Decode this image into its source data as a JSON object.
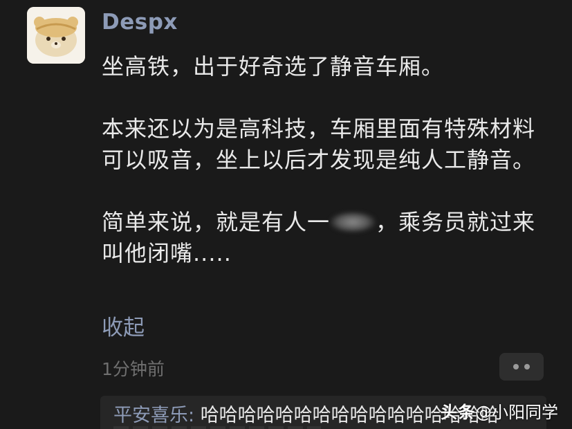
{
  "comment": {
    "username": "Despx",
    "paragraphs": [
      "坐高铁，出于好奇选了静音车厢。",
      "本来还以为是高科技，车厢里面有特殊材料可以吸音，坐上以后才发现是纯人工静音。"
    ],
    "last_paragraph_before": "简单来说，就是有人一",
    "last_paragraph_after": "，乘务员就过来叫他闭嘴.....",
    "collapse_label": "收起",
    "timestamp": "1分钟前"
  },
  "reply": {
    "author": "平安喜乐",
    "separator": ": ",
    "text": "哈哈哈哈哈哈哈哈哈哈哈哈哈哈哈哈"
  },
  "watermark": {
    "brand": "头条",
    "handle": "@小阳同学"
  },
  "icons": {
    "avatar": "bear-avatar-icon",
    "more": "more-dots-icon"
  },
  "colors": {
    "background": "#1a1a1a",
    "username": "#8d9bb7",
    "text": "#e9e9e9",
    "muted": "#6f6f6f"
  }
}
